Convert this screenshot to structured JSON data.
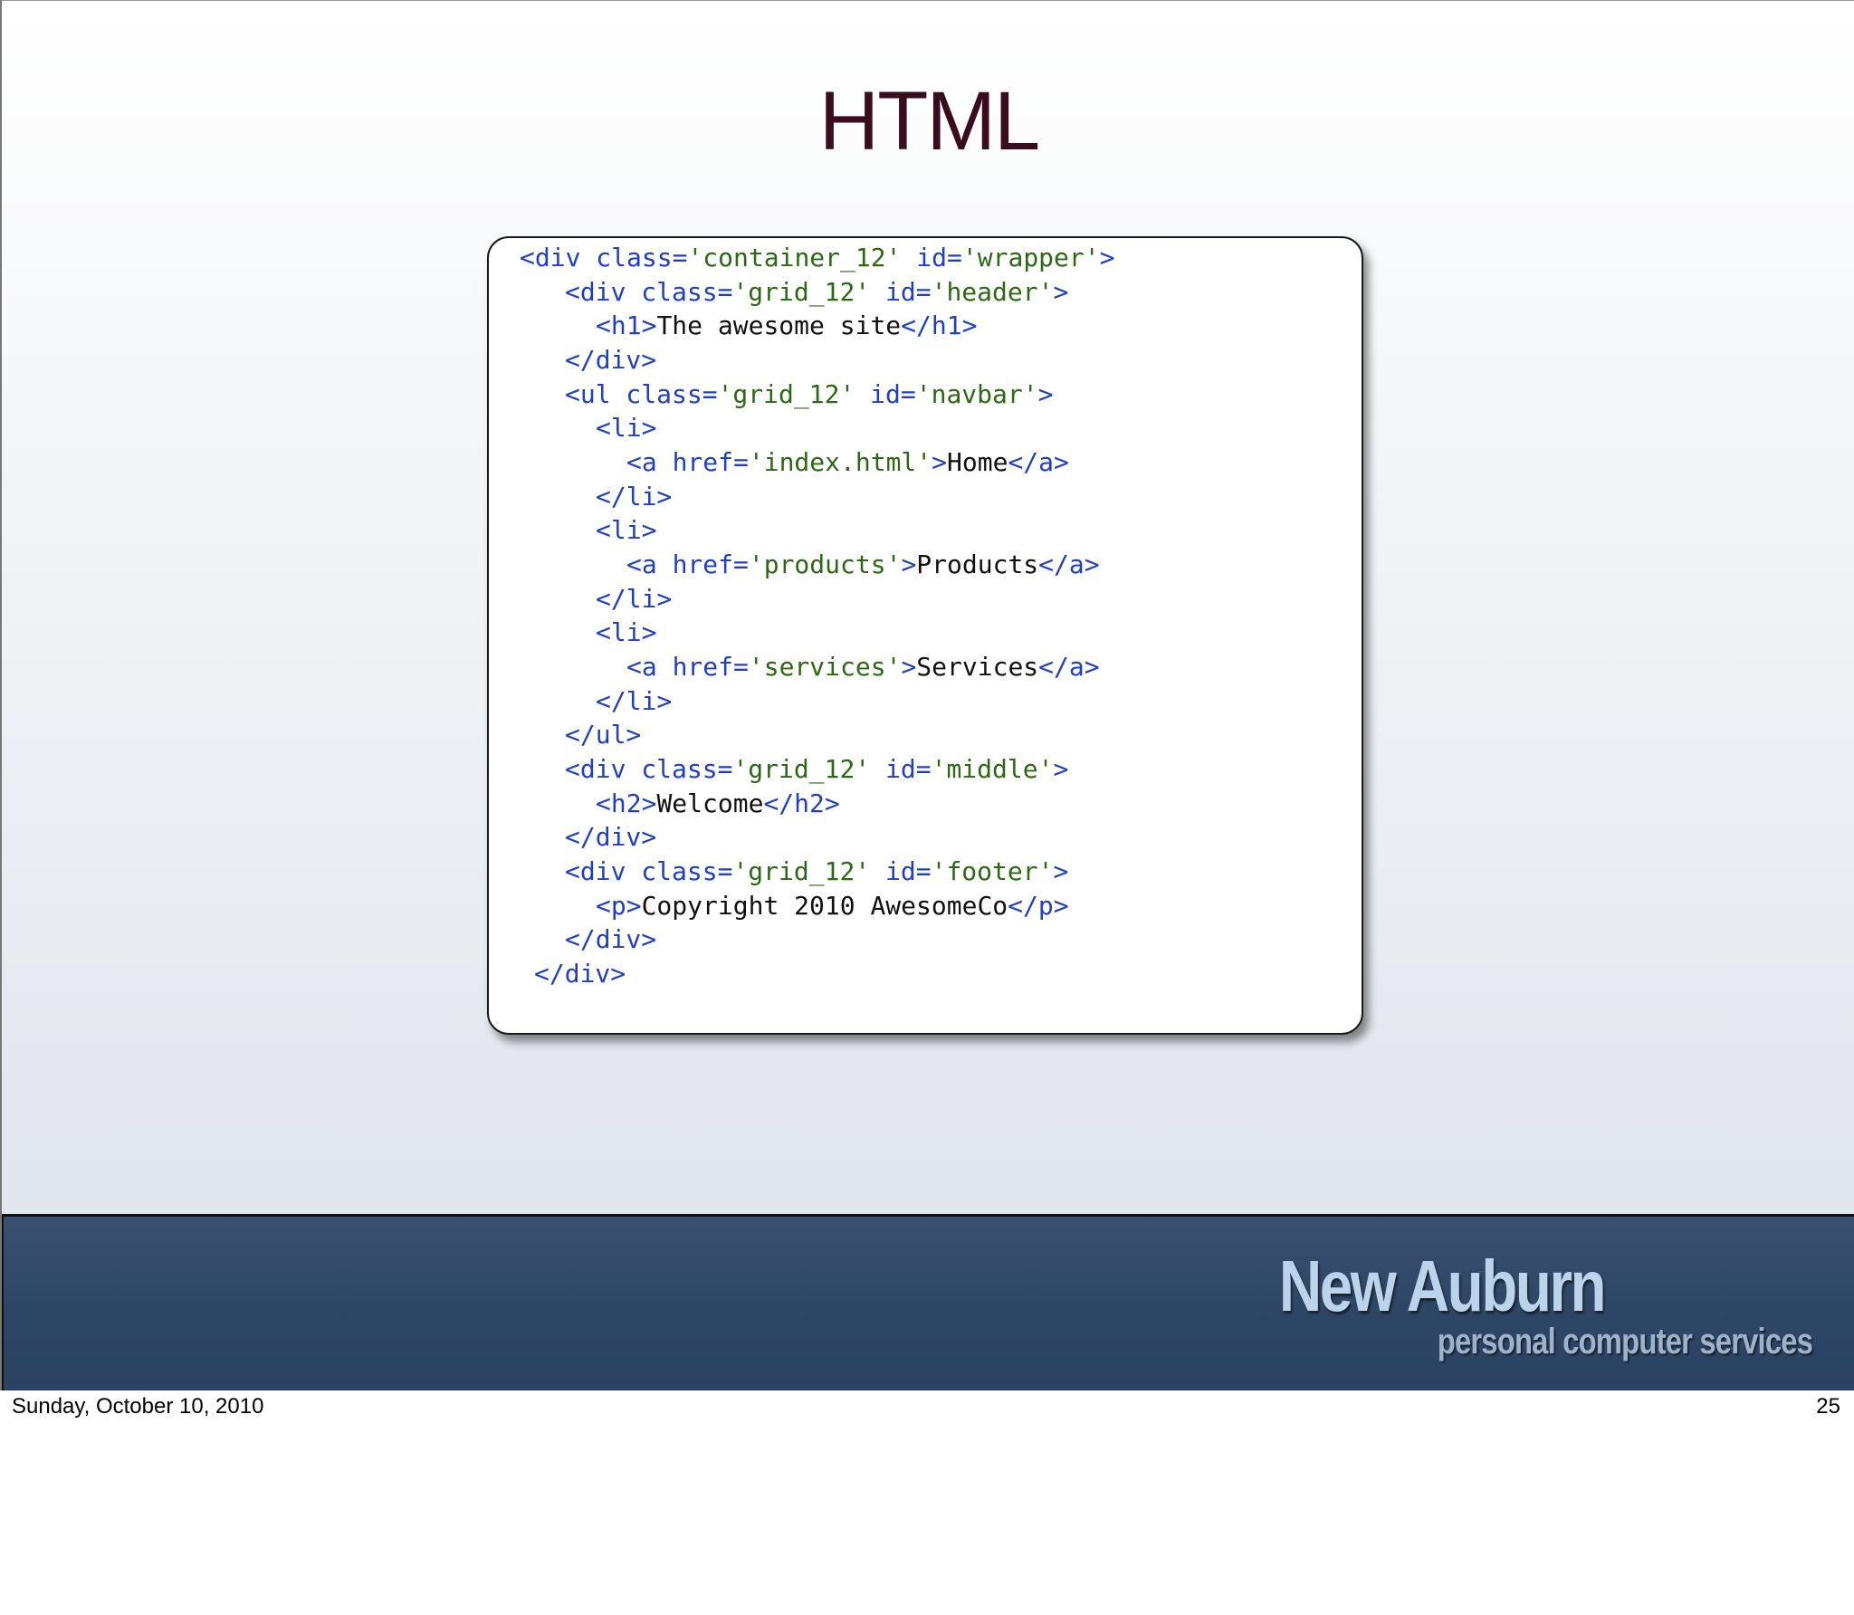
{
  "slide": {
    "title": "HTML",
    "code_lines": [
      [
        {
          "t": "tag",
          "v": "<div class="
        },
        {
          "t": "str",
          "v": "'container_12'"
        },
        {
          "t": "tag",
          "v": " id="
        },
        {
          "t": "str",
          "v": "'wrapper'"
        },
        {
          "t": "tag",
          "v": ">"
        }
      ],
      [
        {
          "t": "tag",
          "v": "<div class="
        },
        {
          "t": "str",
          "v": "'grid_12'"
        },
        {
          "t": "tag",
          "v": " id="
        },
        {
          "t": "str",
          "v": "'header'"
        },
        {
          "t": "tag",
          "v": ">"
        }
      ],
      [
        {
          "t": "tag",
          "v": "<h1>"
        },
        {
          "t": "text",
          "v": "The awesome site"
        },
        {
          "t": "tag",
          "v": "</h1>"
        }
      ],
      [
        {
          "t": "tag",
          "v": "</div>"
        }
      ],
      [
        {
          "t": "tag",
          "v": "<ul class="
        },
        {
          "t": "str",
          "v": "'grid_12'"
        },
        {
          "t": "tag",
          "v": " id="
        },
        {
          "t": "str",
          "v": "'navbar'"
        },
        {
          "t": "tag",
          "v": ">"
        }
      ],
      [
        {
          "t": "tag",
          "v": "<li>"
        }
      ],
      [
        {
          "t": "tag",
          "v": "<a href="
        },
        {
          "t": "str",
          "v": "'index.html'"
        },
        {
          "t": "tag",
          "v": ">"
        },
        {
          "t": "text",
          "v": "Home"
        },
        {
          "t": "tag",
          "v": "</a>"
        }
      ],
      [
        {
          "t": "tag",
          "v": "</li>"
        }
      ],
      [
        {
          "t": "tag",
          "v": "<li>"
        }
      ],
      [
        {
          "t": "tag",
          "v": "<a href="
        },
        {
          "t": "str",
          "v": "'products'"
        },
        {
          "t": "tag",
          "v": ">"
        },
        {
          "t": "text",
          "v": "Products"
        },
        {
          "t": "tag",
          "v": "</a>"
        }
      ],
      [
        {
          "t": "tag",
          "v": "</li>"
        }
      ],
      [
        {
          "t": "tag",
          "v": "<li>"
        }
      ],
      [
        {
          "t": "tag",
          "v": "<a href="
        },
        {
          "t": "str",
          "v": "'services'"
        },
        {
          "t": "tag",
          "v": ">"
        },
        {
          "t": "text",
          "v": "Services"
        },
        {
          "t": "tag",
          "v": "</a>"
        }
      ],
      [
        {
          "t": "tag",
          "v": "</li>"
        }
      ],
      [
        {
          "t": "tag",
          "v": "</ul>"
        }
      ],
      [
        {
          "t": "tag",
          "v": "<div class="
        },
        {
          "t": "str",
          "v": "'grid_12'"
        },
        {
          "t": "tag",
          "v": " id="
        },
        {
          "t": "str",
          "v": "'middle'"
        },
        {
          "t": "tag",
          "v": ">"
        }
      ],
      [
        {
          "t": "tag",
          "v": "<h2>"
        },
        {
          "t": "text",
          "v": "Welcome"
        },
        {
          "t": "tag",
          "v": "</h2>"
        }
      ],
      [
        {
          "t": "tag",
          "v": "</div>"
        }
      ],
      [
        {
          "t": "tag",
          "v": "<div class="
        },
        {
          "t": "str",
          "v": "'grid_12'"
        },
        {
          "t": "tag",
          "v": " id="
        },
        {
          "t": "str",
          "v": "'footer'"
        },
        {
          "t": "tag",
          "v": ">"
        }
      ],
      [
        {
          "t": "tag",
          "v": "<p>"
        },
        {
          "t": "text",
          "v": "Copyright 2010 AwesomeCo"
        },
        {
          "t": "tag",
          "v": "</p>"
        }
      ],
      [
        {
          "t": "tag",
          "v": "</div>"
        }
      ],
      [
        {
          "t": "tag",
          "v": "</div>"
        }
      ]
    ],
    "logo": {
      "main": "New Auburn",
      "sub": "personal computer services"
    }
  },
  "footer": {
    "date": "Sunday, October 10, 2010",
    "page": "25"
  },
  "colors": {
    "title": "#3a0d1e",
    "tag": "#1f3fc8",
    "string": "#2b6a12",
    "text": "#111111",
    "band": "#2f4766",
    "logo": "#bcd3ec"
  }
}
